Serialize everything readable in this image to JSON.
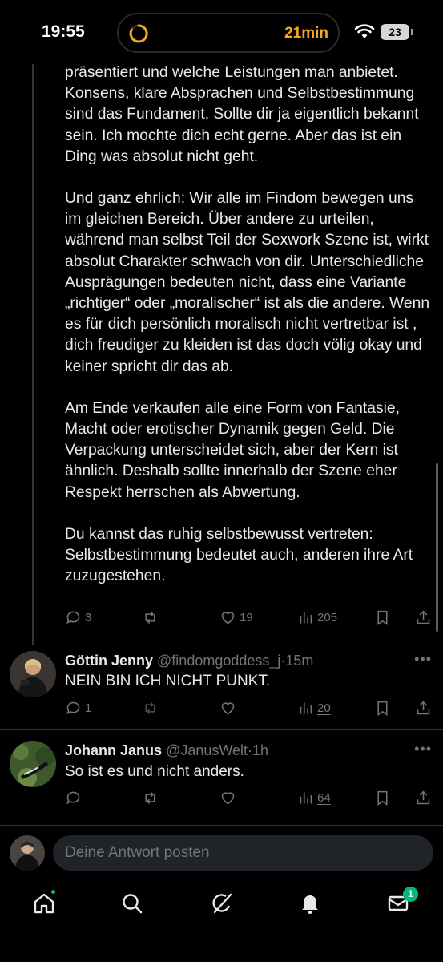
{
  "status_bar": {
    "time": "19:55",
    "timer_text": "21min",
    "battery": "23",
    "timer_color": "#f5a623"
  },
  "main_tweet": {
    "paragraphs": [
      "präsentiert und welche Leistungen man anbietet. Konsens, klare Absprachen und Selbstbestimmung sind das Fundament. Sollte dir ja eigentlich bekannt sein. Ich mochte dich  echt gerne. Aber das ist ein Ding was absolut nicht geht.",
      "Und ganz ehrlich: Wir alle im Findom bewegen uns im gleichen Bereich. Über andere zu urteilen, während man selbst Teil der Sexwork Szene ist, wirkt absolut Charakter schwach von dir. Unterschiedliche Ausprägungen bedeuten nicht, dass eine Variante „richtiger“ oder „moralischer“ ist als die andere. Wenn es für dich persönlich moralisch nicht vertretbar ist , dich freudiger zu kleiden ist das doch völig okay und keiner spricht dir das ab.",
      "Am Ende verkaufen alle eine Form von Fantasie, Macht oder erotischer Dynamik gegen Geld. Die Verpackung unterscheidet sich, aber der Kern ist ähnlich. Deshalb sollte innerhalb der Szene eher Respekt herrschen als Abwertung.",
      "Du kannst das ruhig selbstbewusst vertreten: Selbstbestimmung bedeutet auch, anderen ihre Art zuzugestehen."
    ],
    "replies": "3",
    "likes": "19",
    "views": "205"
  },
  "reply1": {
    "name": "Göttin Jenny",
    "handle": "@findomgoddess_j",
    "time": "15m",
    "text": "NEIN BIN ICH NICHT PUNKT.",
    "replies": "1",
    "views": "20"
  },
  "reply2": {
    "name": "Johann Janus",
    "handle": "@JanusWelt",
    "time": "1h",
    "text": "So ist es und nicht anders.",
    "views": "64"
  },
  "separator": "·",
  "more": "•••",
  "compose": {
    "placeholder": "Deine Antwort posten"
  },
  "nav": {
    "messages_badge": "1",
    "accent": "#00ba7c"
  }
}
